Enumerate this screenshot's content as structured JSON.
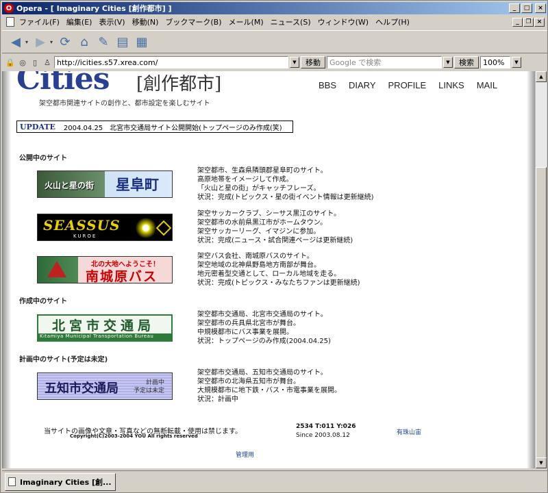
{
  "window": {
    "title": "Opera - [ Imaginary Cities [創作都市] ]",
    "tab_title": "Imaginary Cities [創..."
  },
  "menu": [
    "ファイル(F)",
    "編集(E)",
    "表示(V)",
    "移動(N)",
    "ブックマーク(B)",
    "メール(M)",
    "ニュース(S)",
    "ウィンドウ(W)",
    "ヘルプ(H)"
  ],
  "address": {
    "url": "http://icities.s57.xrea.com/",
    "go_label": "移動",
    "search_placeholder": "Google で検索",
    "search_label": "検索",
    "zoom": "100%"
  },
  "site": {
    "logo": "Cities",
    "logo_sub": "[創作都市]",
    "tagline": "架空都市関連サイトの創作と、都市設定を楽しむサイト",
    "nav": [
      "BBS",
      "DIARY",
      "PROFILE",
      "LINKS",
      "MAIL"
    ],
    "update_label": "UPDATE",
    "update_text": "2004.04.25　北宮市交通局サイト公開開始(トップページのみ作成(笑)"
  },
  "sections": [
    {
      "title": "公開中のサイト",
      "sites": [
        {
          "banner": "火山と星の街 星阜町",
          "banner_a": "火山と星の街",
          "banner_b": "星阜町",
          "lines": [
            "架空都市、生森県隣頭郡星阜町のサイト。",
            "高原地帯をイメージして作成。",
            "「火山と星の街」がキャッチフレーズ。",
            "状況：完成(トピックス・星の街イベント情報は更新継続)"
          ]
        },
        {
          "banner_a": "SEASSUS",
          "banner_b": "KUROE",
          "lines": [
            "架空サッカークラブ、シーサス黒江のサイト。",
            "架空都市の水前県黒江市がホームタウン。",
            "架空サッカーリーグ、イマジンに参加。",
            "状況：完成(ニュース・試合関連ページは更新継続)"
          ]
        },
        {
          "banner_a": "北の大地へようこそ！",
          "banner_b": "南城原バス",
          "lines": [
            "架空バス会社、南城原バスのサイト。",
            "架空地域の北神県野島地方南部が舞台。",
            "地元密着型交通として、ローカル地域を走る。",
            "状況：完成(トピックス・みなたちファンは更新継続)"
          ]
        }
      ]
    },
    {
      "title": "作成中のサイト",
      "sites": [
        {
          "banner_a": "北宮市交通局",
          "banner_b": "Kitamiya Municipal Transportation Bureau",
          "lines": [
            "架空都市交通局、北宮市交通局のサイト。",
            "架空都市の兵具県北宮市が舞台。",
            "中規模都市にバス事業を展開。",
            "状況：トップページのみ作成(2004.04.25)"
          ]
        }
      ]
    },
    {
      "title": "計画中のサイト(予定は未定)",
      "sites": [
        {
          "banner_a": "五知市交通局",
          "banner_b": "計画中",
          "banner_c": "予定は未定",
          "lines": [
            "架空都市交通局、五知市交通局のサイト。",
            "架空都市の北海県五知市が舞台。",
            "大規模都市に地下鉄・バス・市電事業を展開。",
            "状況：計画中"
          ]
        }
      ]
    }
  ],
  "footer": {
    "notice": "当サイトの画像や文章・写真などの無断転載・使用は禁じます。",
    "copyright": "Copyright(C)2003-2004 YOU All rights reserved",
    "counter": "2534 T:011 Y:026",
    "since": "Since 2003.08.12",
    "author_link": "有珠山宙",
    "admin_link": "管理用"
  },
  "colors": {
    "logo": "#2a3f8f",
    "titlebar_start": "#0a246a",
    "titlebar_end": "#a6caf0"
  }
}
